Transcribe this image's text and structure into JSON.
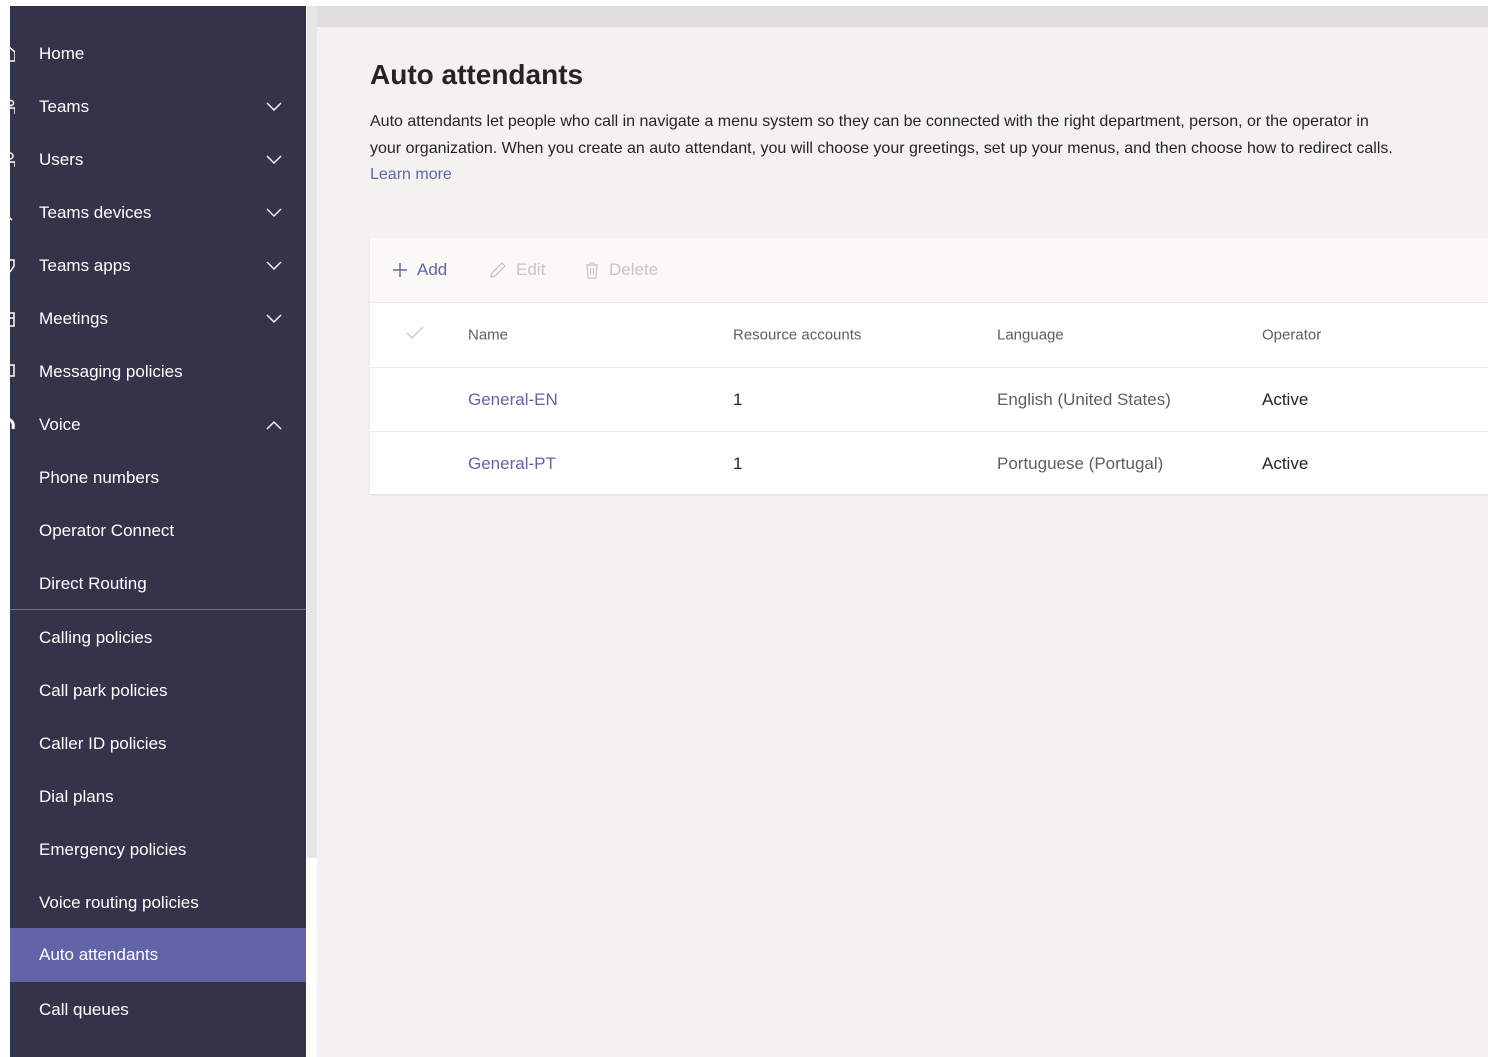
{
  "sidebar": {
    "items": [
      {
        "label": "Home",
        "icon": "home-icon",
        "chevron": "none"
      },
      {
        "label": "Teams",
        "icon": "teams-icon",
        "chevron": "down"
      },
      {
        "label": "Users",
        "icon": "users-icon",
        "chevron": "down"
      },
      {
        "label": "Teams devices",
        "icon": "devices-icon",
        "chevron": "down"
      },
      {
        "label": "Teams apps",
        "icon": "apps-icon",
        "chevron": "down"
      },
      {
        "label": "Meetings",
        "icon": "calendar-icon",
        "chevron": "down"
      },
      {
        "label": "Messaging policies",
        "icon": "chat-icon",
        "chevron": "none"
      },
      {
        "label": "Voice",
        "icon": "phone-icon",
        "chevron": "up"
      },
      {
        "label": "Phone numbers"
      },
      {
        "label": "Operator Connect"
      },
      {
        "label": "Direct Routing"
      },
      {
        "label": "Calling policies"
      },
      {
        "label": "Call park policies"
      },
      {
        "label": "Caller ID policies"
      },
      {
        "label": "Dial plans"
      },
      {
        "label": "Emergency policies"
      },
      {
        "label": "Voice routing policies"
      },
      {
        "label": "Auto attendants",
        "selected": true
      },
      {
        "label": "Call queues"
      }
    ]
  },
  "page": {
    "title": "Auto attendants",
    "description": "Auto attendants let people who call in navigate a menu system so they can be connected with the right department, person, or the operator in your organization. When you create an auto attendant, you will choose your greetings, set up your menus, and then choose how to redirect calls.",
    "learn_more": "Learn more"
  },
  "toolbar": {
    "add_label": "Add",
    "edit_label": "Edit",
    "delete_label": "Delete"
  },
  "table": {
    "columns": [
      "Name",
      "Resource accounts",
      "Language",
      "Operator"
    ],
    "rows": [
      {
        "name": "General-EN",
        "resource_accounts": "1",
        "language": "English (United States)",
        "operator": "Active"
      },
      {
        "name": "General-PT",
        "resource_accounts": "1",
        "language": "Portuguese (Portugal)",
        "operator": "Active"
      }
    ]
  },
  "colors": {
    "sidebar_bg": "#33344a",
    "selected_bg": "#6264a7",
    "accent": "#6264a7",
    "main_bg": "#f3f2f1"
  }
}
